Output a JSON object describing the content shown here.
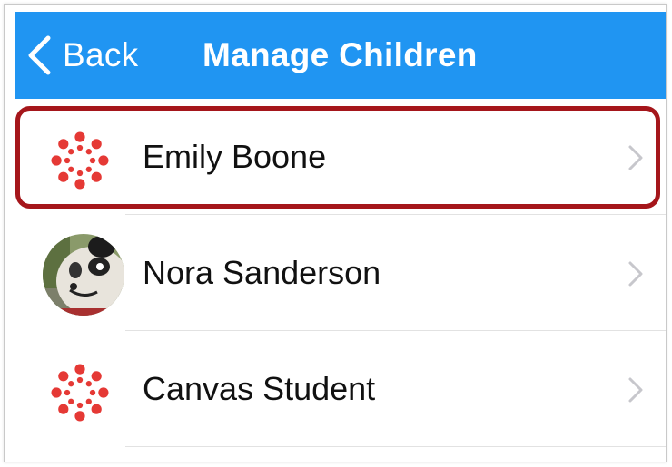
{
  "nav": {
    "back_label": "Back",
    "title": "Manage Children",
    "bar_color": "#2095f2"
  },
  "children": [
    {
      "name": "Emily Boone",
      "avatar": "canvas-logo-icon",
      "highlighted": true
    },
    {
      "name": "Nora Sanderson",
      "avatar": "panda-photo"
    },
    {
      "name": "Canvas Student",
      "avatar": "canvas-logo-icon"
    }
  ],
  "colors": {
    "canvas_red": "#e53935",
    "highlight_border": "#a5161b",
    "chevron": "#c7c7cc"
  }
}
